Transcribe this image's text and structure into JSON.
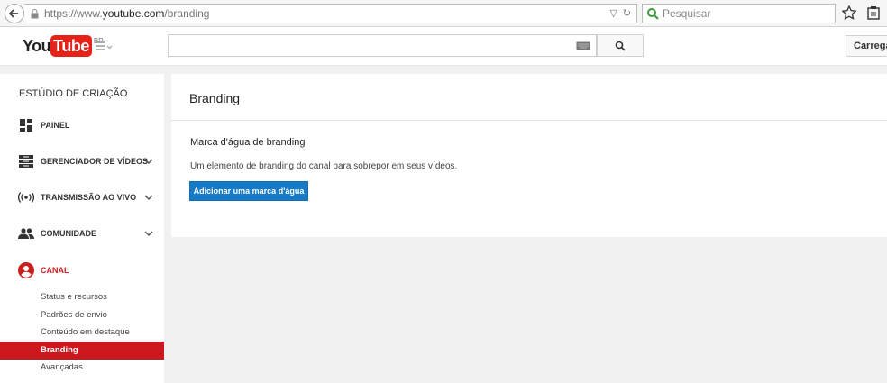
{
  "browser": {
    "url_prefix": "https://www.",
    "url_domain": "youtube.com",
    "url_path": "/branding",
    "search_placeholder": "Pesquisar"
  },
  "header": {
    "logo_you": "You",
    "logo_tube": "Tube",
    "logo_country": "BR",
    "upload_label": "Carregar"
  },
  "sidebar": {
    "title": "ESTÚDIO DE CRIAÇÃO",
    "items": [
      {
        "label": "PAINEL",
        "icon": "dashboard-icon"
      },
      {
        "label": "GERENCIADOR DE VÍDEOS",
        "icon": "video-manager-icon"
      },
      {
        "label": "TRANSMISSÃO AO VIVO",
        "icon": "live-broadcast-icon"
      },
      {
        "label": "COMUNIDADE",
        "icon": "community-icon"
      },
      {
        "label": "CANAL",
        "icon": "channel-icon"
      }
    ],
    "sub_items": [
      {
        "label": "Status e recursos"
      },
      {
        "label": "Padrões de envio"
      },
      {
        "label": "Conteúdo em destaque"
      },
      {
        "label": "Branding"
      },
      {
        "label": "Avançadas"
      }
    ]
  },
  "main": {
    "title": "Branding",
    "section_title": "Marca d'água de branding",
    "section_desc": "Um elemento de branding do canal para sobrepor em seus vídeos.",
    "add_button_label": "Adicionar uma marca d'água"
  },
  "colors": {
    "brand_red": "#e62117",
    "active_red": "#cc181e",
    "button_blue": "#167ac6"
  }
}
